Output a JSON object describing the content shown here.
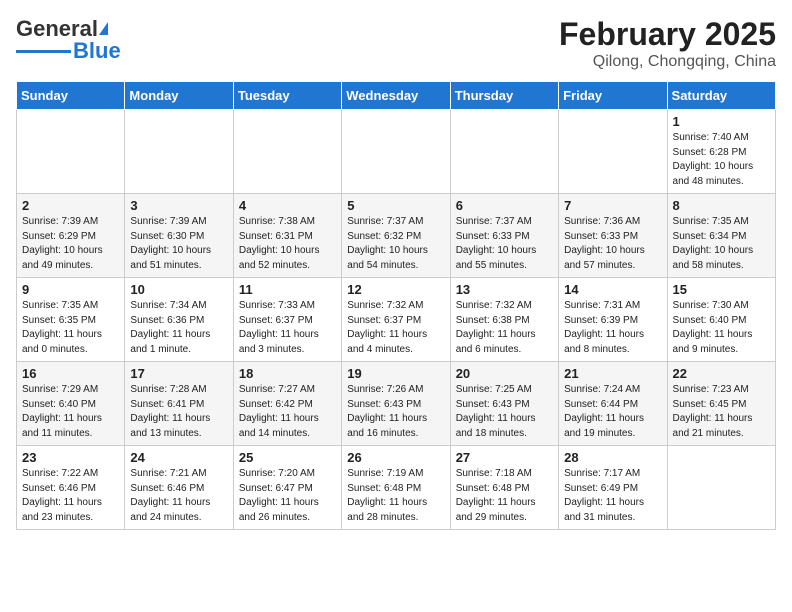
{
  "logo": {
    "general": "General",
    "blue": "Blue"
  },
  "header": {
    "month": "February 2025",
    "location": "Qilong, Chongqing, China"
  },
  "weekdays": [
    "Sunday",
    "Monday",
    "Tuesday",
    "Wednesday",
    "Thursday",
    "Friday",
    "Saturday"
  ],
  "weeks": [
    [
      {
        "day": "",
        "info": ""
      },
      {
        "day": "",
        "info": ""
      },
      {
        "day": "",
        "info": ""
      },
      {
        "day": "",
        "info": ""
      },
      {
        "day": "",
        "info": ""
      },
      {
        "day": "",
        "info": ""
      },
      {
        "day": "1",
        "info": "Sunrise: 7:40 AM\nSunset: 6:28 PM\nDaylight: 10 hours\nand 48 minutes."
      }
    ],
    [
      {
        "day": "2",
        "info": "Sunrise: 7:39 AM\nSunset: 6:29 PM\nDaylight: 10 hours\nand 49 minutes."
      },
      {
        "day": "3",
        "info": "Sunrise: 7:39 AM\nSunset: 6:30 PM\nDaylight: 10 hours\nand 51 minutes."
      },
      {
        "day": "4",
        "info": "Sunrise: 7:38 AM\nSunset: 6:31 PM\nDaylight: 10 hours\nand 52 minutes."
      },
      {
        "day": "5",
        "info": "Sunrise: 7:37 AM\nSunset: 6:32 PM\nDaylight: 10 hours\nand 54 minutes."
      },
      {
        "day": "6",
        "info": "Sunrise: 7:37 AM\nSunset: 6:33 PM\nDaylight: 10 hours\nand 55 minutes."
      },
      {
        "day": "7",
        "info": "Sunrise: 7:36 AM\nSunset: 6:33 PM\nDaylight: 10 hours\nand 57 minutes."
      },
      {
        "day": "8",
        "info": "Sunrise: 7:35 AM\nSunset: 6:34 PM\nDaylight: 10 hours\nand 58 minutes."
      }
    ],
    [
      {
        "day": "9",
        "info": "Sunrise: 7:35 AM\nSunset: 6:35 PM\nDaylight: 11 hours\nand 0 minutes."
      },
      {
        "day": "10",
        "info": "Sunrise: 7:34 AM\nSunset: 6:36 PM\nDaylight: 11 hours\nand 1 minute."
      },
      {
        "day": "11",
        "info": "Sunrise: 7:33 AM\nSunset: 6:37 PM\nDaylight: 11 hours\nand 3 minutes."
      },
      {
        "day": "12",
        "info": "Sunrise: 7:32 AM\nSunset: 6:37 PM\nDaylight: 11 hours\nand 4 minutes."
      },
      {
        "day": "13",
        "info": "Sunrise: 7:32 AM\nSunset: 6:38 PM\nDaylight: 11 hours\nand 6 minutes."
      },
      {
        "day": "14",
        "info": "Sunrise: 7:31 AM\nSunset: 6:39 PM\nDaylight: 11 hours\nand 8 minutes."
      },
      {
        "day": "15",
        "info": "Sunrise: 7:30 AM\nSunset: 6:40 PM\nDaylight: 11 hours\nand 9 minutes."
      }
    ],
    [
      {
        "day": "16",
        "info": "Sunrise: 7:29 AM\nSunset: 6:40 PM\nDaylight: 11 hours\nand 11 minutes."
      },
      {
        "day": "17",
        "info": "Sunrise: 7:28 AM\nSunset: 6:41 PM\nDaylight: 11 hours\nand 13 minutes."
      },
      {
        "day": "18",
        "info": "Sunrise: 7:27 AM\nSunset: 6:42 PM\nDaylight: 11 hours\nand 14 minutes."
      },
      {
        "day": "19",
        "info": "Sunrise: 7:26 AM\nSunset: 6:43 PM\nDaylight: 11 hours\nand 16 minutes."
      },
      {
        "day": "20",
        "info": "Sunrise: 7:25 AM\nSunset: 6:43 PM\nDaylight: 11 hours\nand 18 minutes."
      },
      {
        "day": "21",
        "info": "Sunrise: 7:24 AM\nSunset: 6:44 PM\nDaylight: 11 hours\nand 19 minutes."
      },
      {
        "day": "22",
        "info": "Sunrise: 7:23 AM\nSunset: 6:45 PM\nDaylight: 11 hours\nand 21 minutes."
      }
    ],
    [
      {
        "day": "23",
        "info": "Sunrise: 7:22 AM\nSunset: 6:46 PM\nDaylight: 11 hours\nand 23 minutes."
      },
      {
        "day": "24",
        "info": "Sunrise: 7:21 AM\nSunset: 6:46 PM\nDaylight: 11 hours\nand 24 minutes."
      },
      {
        "day": "25",
        "info": "Sunrise: 7:20 AM\nSunset: 6:47 PM\nDaylight: 11 hours\nand 26 minutes."
      },
      {
        "day": "26",
        "info": "Sunrise: 7:19 AM\nSunset: 6:48 PM\nDaylight: 11 hours\nand 28 minutes."
      },
      {
        "day": "27",
        "info": "Sunrise: 7:18 AM\nSunset: 6:48 PM\nDaylight: 11 hours\nand 29 minutes."
      },
      {
        "day": "28",
        "info": "Sunrise: 7:17 AM\nSunset: 6:49 PM\nDaylight: 11 hours\nand 31 minutes."
      },
      {
        "day": "",
        "info": ""
      }
    ]
  ]
}
